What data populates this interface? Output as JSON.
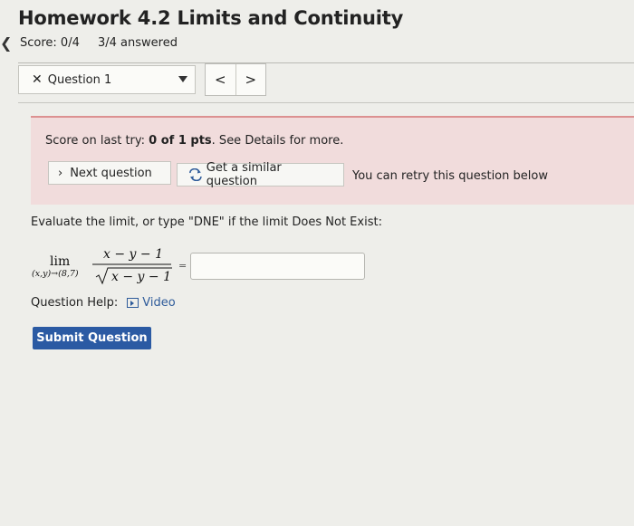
{
  "header": {
    "title": "Homework 4.2 Limits and Continuity",
    "score": "Score: 0/4",
    "answered": "3/4 answered"
  },
  "question_nav": {
    "selected_question": "Question 1",
    "status_icon": "x-mark",
    "prev_label": "<",
    "next_label": ">"
  },
  "alert": {
    "prefix": "Score on last try: ",
    "score_value": "0 of 1 pts",
    "suffix": ". See Details for more.",
    "next_button": "Next question",
    "similar_button": "Get a similar question",
    "retry_note": "You can retry this question below"
  },
  "question": {
    "prompt": "Evaluate the limit, or type \"DNE\" if the limit Does Not Exist:",
    "lim_word": "lim",
    "lim_sub": "(x,y)→(8,7)",
    "numerator": "x − y − 1",
    "denominator": "x − y − 1",
    "equals": "=",
    "answer_value": ""
  },
  "help": {
    "label": "Question Help:",
    "video_label": "Video",
    "video_icon": "play-box-icon"
  },
  "submit_label": "Submit Question",
  "colors": {
    "alert_bg": "#f1dcdc",
    "alert_border": "#dc9191",
    "link": "#2e5b9a",
    "submit_bg": "#2b5aa3"
  }
}
